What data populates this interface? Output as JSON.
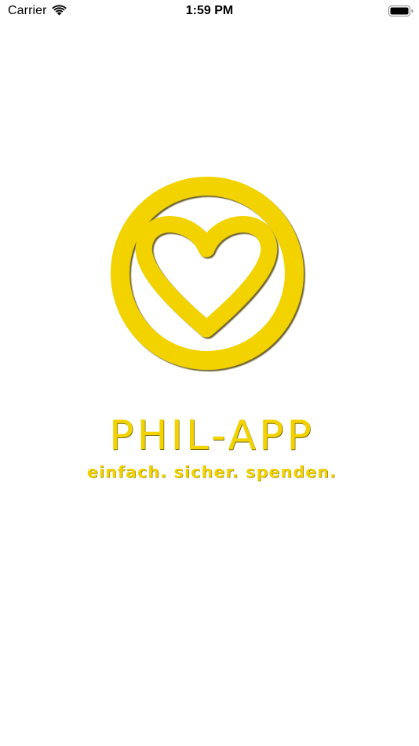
{
  "status_bar": {
    "carrier": "Carrier",
    "time": "1:59 PM",
    "wifi_icon": "wifi-icon",
    "battery_icon": "battery-full-icon"
  },
  "splash": {
    "logo_icon": "heart-in-circle-icon",
    "brand_name": "PHIL-APP",
    "tagline": "einfach. sicher. spenden."
  },
  "colors": {
    "brand_yellow": "#F2D300",
    "shadow": "#5a4e0c",
    "background": "#FFFFFF",
    "status_text": "#000000"
  }
}
